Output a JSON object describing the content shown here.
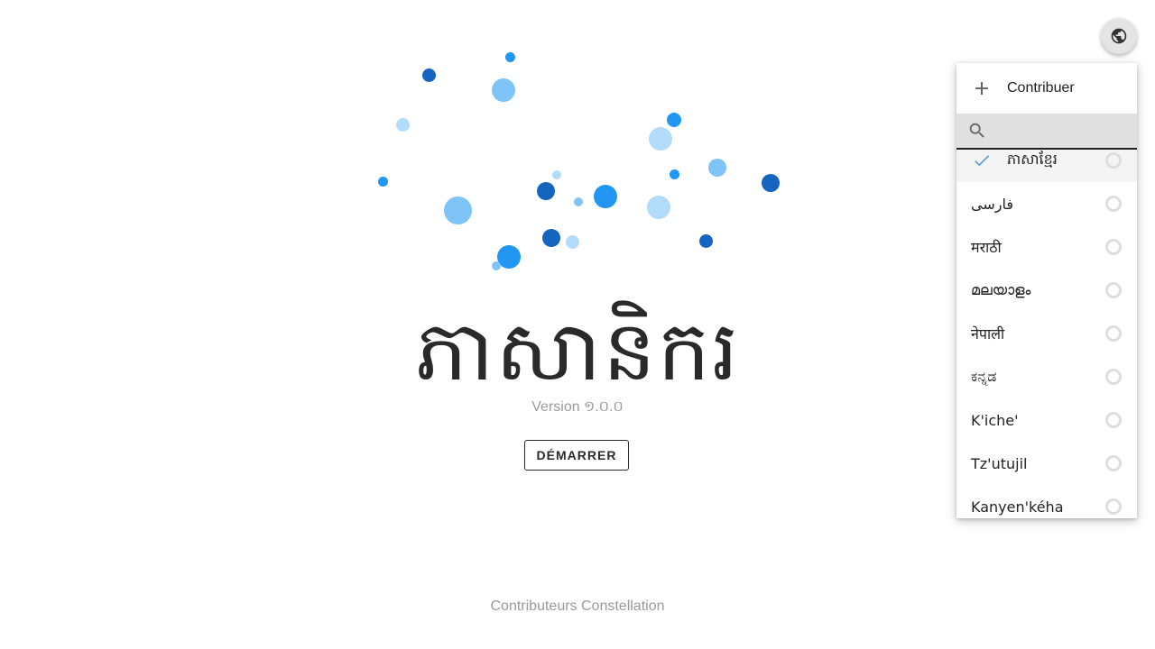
{
  "app": {
    "title": "ភាសានិករ",
    "version_label": "Version ១.០.០",
    "start_label": "DÉMARRER",
    "footer": "Contributeurs Constellation"
  },
  "header": {
    "language_button_icon": "globe-icon"
  },
  "menu": {
    "contribute_label": "Contribuer",
    "contribute_icon": "plus-icon",
    "search_icon": "search-icon",
    "search_value": "",
    "languages": [
      {
        "label": "ភាសាខ្មែរ",
        "selected": true
      },
      {
        "label": "فارسی",
        "selected": false
      },
      {
        "label": "मराठी",
        "selected": false
      },
      {
        "label": "മലയാളം",
        "selected": false
      },
      {
        "label": "नेपाली",
        "selected": false
      },
      {
        "label": "ಕನ್ನಡ",
        "selected": false
      },
      {
        "label": "K'iche'",
        "selected": false
      },
      {
        "label": "Tz'utujil",
        "selected": false
      },
      {
        "label": "Kanyen'kéha",
        "selected": false
      }
    ]
  },
  "colors": {
    "dot_dark": "#1565c0",
    "dot_mid": "#2196f3",
    "dot_light": "#7ec4f7",
    "dot_pale": "#b3dcfa",
    "check": "#6a9fd8"
  }
}
